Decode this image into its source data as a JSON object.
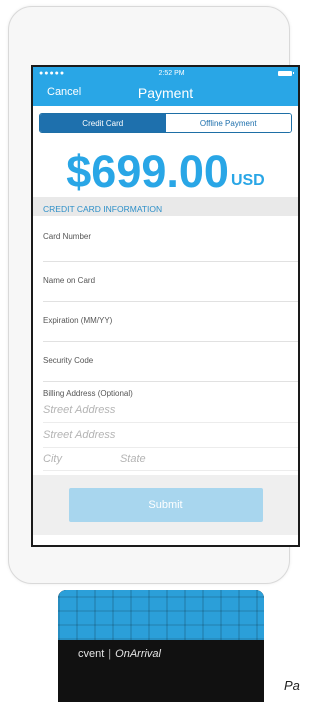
{
  "status_bar": {
    "signal": "●●●●●",
    "time": "2:52 PM"
  },
  "nav": {
    "cancel_label": "Cancel",
    "title": "Payment"
  },
  "segments": [
    {
      "label": "Credit Card",
      "active": true
    },
    {
      "label": "Offline Payment",
      "active": false
    }
  ],
  "amount": {
    "value": "$699.00",
    "currency": "USD"
  },
  "section_header": "CREDIT CARD INFORMATION",
  "fields": [
    {
      "label": "Card Number"
    },
    {
      "label": "Name on Card"
    },
    {
      "label": "Expiration (MM/YY)"
    },
    {
      "label": "Security Code"
    }
  ],
  "billing": {
    "label": "Billing Address (Optional)",
    "street1_placeholder": "Street Address",
    "street2_placeholder": "Street Address",
    "city_placeholder": "City",
    "state_placeholder": "State"
  },
  "submit_label": "Submit",
  "reader": {
    "brand": "cvent",
    "product": "OnArrival"
  },
  "caption": "Pa",
  "colors": {
    "accent": "#29a6e6",
    "segment_active": "#1e70ad",
    "submit_disabled": "#a8d6ee",
    "reader_top": "#2b9fd9"
  }
}
